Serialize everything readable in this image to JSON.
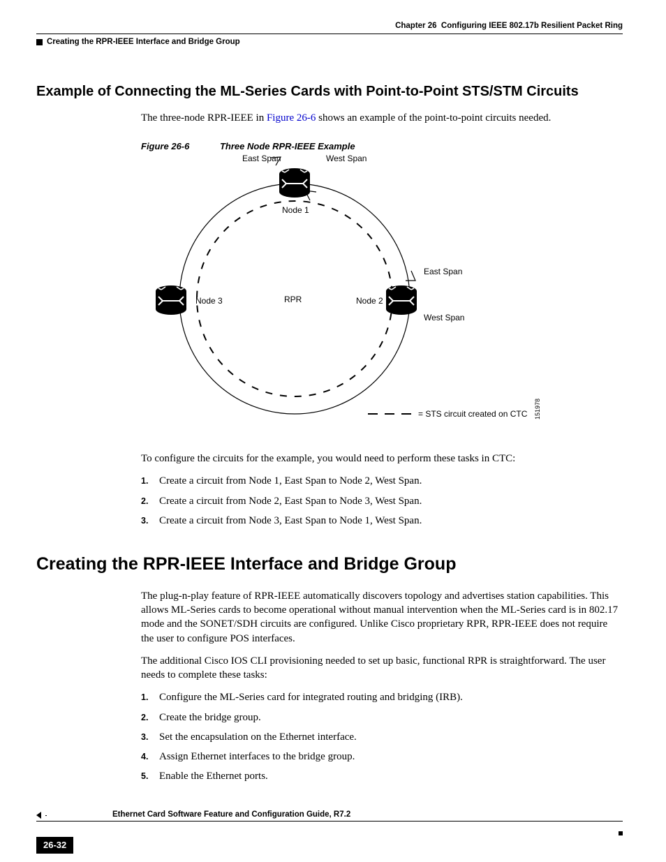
{
  "header": {
    "chapter": "Chapter 26",
    "chapter_title": "Configuring IEEE 802.17b Resilient Packet Ring",
    "section": "Creating the RPR-IEEE Interface and Bridge Group"
  },
  "section1": {
    "heading": "Example of Connecting the ML-Series Cards with Point-to-Point STS/STM Circuits",
    "intro_a": "The three-node RPR-IEEE in ",
    "figref": "Figure 26-6",
    "intro_b": " shows an example of the point-to-point circuits needed."
  },
  "figure": {
    "number": "Figure 26-6",
    "title": "Three Node RPR-IEEE Example",
    "labels": {
      "east_top": "East Span",
      "west_top": "West Span",
      "node1": "Node 1",
      "node2": "Node 2",
      "node3": "Node 3",
      "center": "RPR",
      "east_r": "East Span",
      "west_r": "West Span",
      "legend": "= STS circuit created on CTC",
      "id": "151978"
    }
  },
  "config_intro": "To configure the circuits for the example, you would need to perform these tasks in CTC:",
  "config_steps": [
    "Create a circuit from Node 1, East Span to Node 2, West Span.",
    "Create a circuit from Node 2, East Span to Node 3, West Span.",
    "Create a circuit from Node 3, East Span to Node 1, West Span."
  ],
  "section2": {
    "heading": "Creating the RPR-IEEE Interface and Bridge Group",
    "para1": "The plug-n-play feature of RPR-IEEE automatically discovers topology and advertises station capabilities. This allows ML-Series cards to become operational without manual intervention when the ML-Series card is in 802.17 mode and the SONET/SDH circuits are configured. Unlike Cisco proprietary RPR, RPR-IEEE does not require the user to configure POS interfaces.",
    "para2": "The additional Cisco IOS CLI provisioning needed to set up basic, functional RPR is straightforward. The user needs to complete these tasks:"
  },
  "tasks": [
    "Configure the ML-Series card for integrated routing and bridging (IRB).",
    "Create the bridge group.",
    "Set the encapsulation on the Ethernet interface.",
    "Assign Ethernet interfaces to the bridge group.",
    "Enable the Ethernet ports."
  ],
  "footer": {
    "title": "Ethernet Card Software Feature and Configuration Guide, R7.2",
    "page": "26-32"
  }
}
